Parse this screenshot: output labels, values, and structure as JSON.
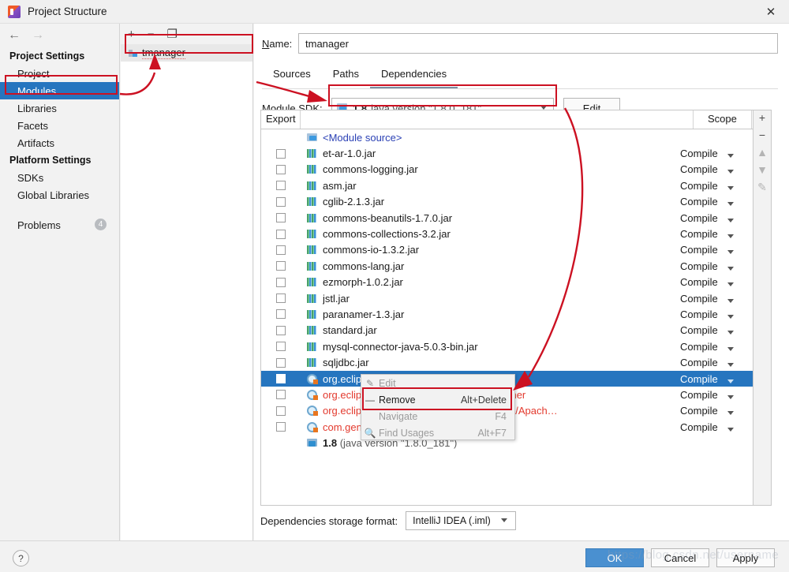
{
  "window": {
    "title": "Project Structure",
    "close_label": "✕",
    "app_icon": "intellij-icon"
  },
  "sidebar": {
    "back_arrow": "←",
    "forward_arrow": "→",
    "groups": [
      {
        "title": "Project Settings",
        "items": [
          {
            "label": "Project",
            "selected": false
          },
          {
            "label": "Modules",
            "selected": true
          },
          {
            "label": "Libraries",
            "selected": false
          },
          {
            "label": "Facets",
            "selected": false
          },
          {
            "label": "Artifacts",
            "selected": false
          }
        ]
      },
      {
        "title": "Platform Settings",
        "items": [
          {
            "label": "SDKs",
            "selected": false
          },
          {
            "label": "Global Libraries",
            "selected": false
          }
        ]
      }
    ],
    "problems": {
      "label": "Problems",
      "count": "4"
    }
  },
  "modules_panel": {
    "toolbar": {
      "add": "+",
      "remove": "−",
      "copy": "❐"
    },
    "items": [
      {
        "label": "tmanager",
        "selected": true
      }
    ]
  },
  "module_form": {
    "name_label": "Name:",
    "name_value": "tmanager",
    "name_placeholder": "",
    "tabs": [
      {
        "label": "Sources",
        "active": false
      },
      {
        "label": "Paths",
        "active": false
      },
      {
        "label": "Dependencies",
        "active": true
      }
    ],
    "sdk_label": "Module SDK:",
    "sdk_version": "1.8",
    "sdk_description": "java version \"1.8.0_181\"",
    "edit_button": "Edit"
  },
  "dependencies_table": {
    "columns": {
      "export": "Export",
      "name": "",
      "scope": "Scope"
    },
    "side_toolbar": {
      "add": "+",
      "remove": "−",
      "up": "▲",
      "down": "▼",
      "edit": "✎"
    },
    "rows": [
      {
        "checkbox": false,
        "show_checkbox": false,
        "icon": "module-source-icon",
        "label": "<Module source>",
        "style": "link",
        "scope": ""
      },
      {
        "checkbox": false,
        "show_checkbox": true,
        "icon": "jar-icon",
        "label": "et-ar-1.0.jar",
        "style": "normal",
        "scope": "Compile"
      },
      {
        "checkbox": false,
        "show_checkbox": true,
        "icon": "jar-icon",
        "label": "commons-logging.jar",
        "style": "normal",
        "scope": "Compile"
      },
      {
        "checkbox": false,
        "show_checkbox": true,
        "icon": "jar-icon",
        "label": "asm.jar",
        "style": "normal",
        "scope": "Compile"
      },
      {
        "checkbox": false,
        "show_checkbox": true,
        "icon": "jar-icon",
        "label": "cglib-2.1.3.jar",
        "style": "normal",
        "scope": "Compile"
      },
      {
        "checkbox": false,
        "show_checkbox": true,
        "icon": "jar-icon",
        "label": "commons-beanutils-1.7.0.jar",
        "style": "normal",
        "scope": "Compile"
      },
      {
        "checkbox": false,
        "show_checkbox": true,
        "icon": "jar-icon",
        "label": "commons-collections-3.2.jar",
        "style": "normal",
        "scope": "Compile"
      },
      {
        "checkbox": false,
        "show_checkbox": true,
        "icon": "jar-icon",
        "label": "commons-io-1.3.2.jar",
        "style": "normal",
        "scope": "Compile"
      },
      {
        "checkbox": false,
        "show_checkbox": true,
        "icon": "jar-icon",
        "label": "commons-lang.jar",
        "style": "normal",
        "scope": "Compile"
      },
      {
        "checkbox": false,
        "show_checkbox": true,
        "icon": "jar-icon",
        "label": "ezmorph-1.0.2.jar",
        "style": "normal",
        "scope": "Compile"
      },
      {
        "checkbox": false,
        "show_checkbox": true,
        "icon": "jar-icon",
        "label": "jstl.jar",
        "style": "normal",
        "scope": "Compile"
      },
      {
        "checkbox": false,
        "show_checkbox": true,
        "icon": "jar-icon",
        "label": "paranamer-1.3.jar",
        "style": "normal",
        "scope": "Compile"
      },
      {
        "checkbox": false,
        "show_checkbox": true,
        "icon": "jar-icon",
        "label": "standard.jar",
        "style": "normal",
        "scope": "Compile"
      },
      {
        "checkbox": false,
        "show_checkbox": true,
        "icon": "jar-icon",
        "label": "mysql-connector-java-5.0.3-bin.jar",
        "style": "normal",
        "scope": "Compile"
      },
      {
        "checkbox": false,
        "show_checkbox": true,
        "icon": "jar-icon",
        "label": "sqljdbc.jar",
        "style": "normal",
        "scope": "Compile"
      },
      {
        "checkbox": false,
        "show_checkbox": true,
        "icon": "library-icon",
        "label": "org.eclipse.jst.j2ee.internal.web.container",
        "style": "selected",
        "scope": "Compile",
        "selected": true
      },
      {
        "checkbox": false,
        "show_checkbox": true,
        "icon": "library-icon",
        "label": "org.eclipse.jst.j2ee.internal.module.container",
        "style": "error",
        "scope": "Compile"
      },
      {
        "checkbox": false,
        "show_checkbox": true,
        "icon": "library-icon",
        "label": "org.eclipse.jst.server.tomcat.runtimeTarget/Apach…",
        "style": "error",
        "scope": "Compile"
      },
      {
        "checkbox": false,
        "show_checkbox": true,
        "icon": "library-icon",
        "label": "com.genuitec.runtime.generic.generic_1.4",
        "style": "error",
        "scope": "Compile"
      },
      {
        "checkbox": false,
        "show_checkbox": false,
        "icon": "sdk-icon",
        "label": "1.8",
        "label_suffix": "(java version \"1.8.0_181\")",
        "style": "sdk",
        "scope": ""
      }
    ]
  },
  "context_menu": {
    "items": [
      {
        "icon": "pencil-icon",
        "label": "Edit",
        "shortcut": "",
        "enabled": false
      },
      {
        "icon": "minus-icon",
        "label": "Remove",
        "shortcut": "Alt+Delete",
        "enabled": true
      },
      {
        "icon": "",
        "label": "Navigate",
        "shortcut": "F4",
        "enabled": false
      },
      {
        "icon": "magnifier-icon",
        "label": "Find Usages",
        "shortcut": "Alt+F7",
        "enabled": false
      }
    ]
  },
  "storage": {
    "label": "Dependencies storage format:",
    "value": "IntelliJ IDEA (.iml)"
  },
  "footer": {
    "help": "?",
    "ok": "OK",
    "cancel": "Cancel",
    "apply": "Apply"
  },
  "watermark": {
    "text": "https://blog.csdn.net/username"
  },
  "colors": {
    "accent": "#2675bf",
    "annotation": "#cc1122",
    "error_text": "#e33a2e",
    "link_text": "#2b41b5",
    "primary_button": "#4a90d0"
  }
}
